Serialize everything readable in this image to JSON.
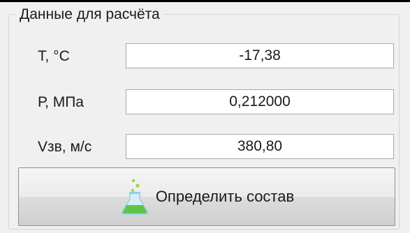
{
  "group": {
    "title": "Данные для расчёта"
  },
  "fields": {
    "temperature": {
      "label": "Т, °С",
      "value": "-17,38"
    },
    "pressure": {
      "label": "Р, МПа",
      "value": "0,212000"
    },
    "sound_speed": {
      "label": "Vзв, м/с",
      "value": "380,80"
    }
  },
  "button": {
    "label": "Определить состав",
    "icon": "flask-icon"
  },
  "colors": {
    "flask_liquid": "#5cc64a",
    "flask_glass": "#8fd0e6",
    "bubble": "#9bd34a"
  }
}
